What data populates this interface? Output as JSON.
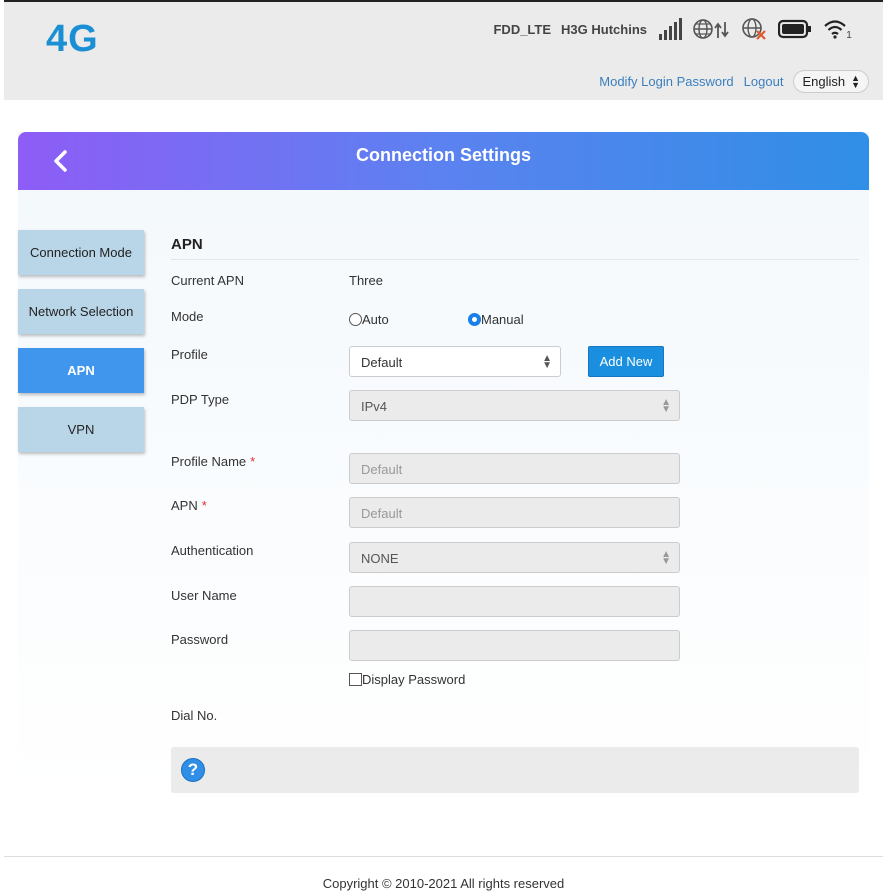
{
  "header": {
    "logo": "4G",
    "network_type": "FDD_LTE",
    "operator": "H3G Hutchins",
    "wifi_count": "1",
    "modify_password_link": "Modify Login Password",
    "logout_link": "Logout",
    "language": "English",
    "icons": [
      "signal-bars-icon",
      "internet-data-icon",
      "globe-disconnected-icon",
      "battery-icon",
      "wifi-icon"
    ]
  },
  "page": {
    "title": "Connection Settings"
  },
  "sidenav": {
    "items": [
      {
        "label": "Connection Mode",
        "active": false
      },
      {
        "label": "Network Selection",
        "active": false
      },
      {
        "label": "APN",
        "active": true
      },
      {
        "label": "VPN",
        "active": false
      }
    ]
  },
  "apn": {
    "section_title": "APN",
    "current_apn_label": "Current APN",
    "current_apn_value": "Three",
    "mode_label": "Mode",
    "mode_auto": "Auto",
    "mode_manual": "Manual",
    "mode_selected": "Manual",
    "profile_label": "Profile",
    "profile_value": "Default",
    "add_new_label": "Add New",
    "pdp_type_label": "PDP Type",
    "pdp_type_value": "IPv4",
    "profile_name_label": "Profile Name",
    "profile_name_placeholder": "Default",
    "apn_label": "APN",
    "apn_placeholder": "Default",
    "required_mark": "*",
    "authentication_label": "Authentication",
    "authentication_value": "NONE",
    "username_label": "User Name",
    "password_label": "Password",
    "display_password_label": "Display Password",
    "dial_no_label": "Dial No.",
    "help_symbol": "?"
  },
  "footer": {
    "copyright": "Copyright © 2010-2021 All rights reserved"
  },
  "colors": {
    "accent": "#1a8fe0",
    "active_nav": "#3f96ec",
    "nav_item": "#b9d6e8",
    "header_gradient_start": "#8e5cf6",
    "header_gradient_end": "#2f8fe6",
    "logo": "#1a8fd4"
  }
}
